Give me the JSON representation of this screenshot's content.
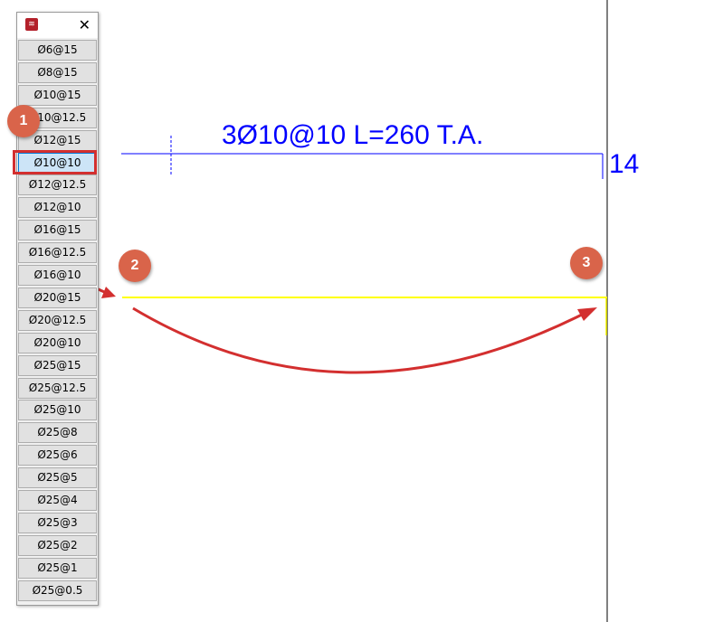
{
  "panel": {
    "close_label": "✕",
    "selected": "Ø10@10",
    "items": [
      "Ø6@15",
      "Ø8@15",
      "Ø10@15",
      "Ø10@12.5",
      "Ø12@15",
      "Ø10@10",
      "Ø12@12.5",
      "Ø12@10",
      "Ø16@15",
      "Ø16@12.5",
      "Ø16@10",
      "Ø20@15",
      "Ø20@12.5",
      "Ø20@10",
      "Ø25@15",
      "Ø25@12.5",
      "Ø25@10",
      "Ø25@8",
      "Ø25@6",
      "Ø25@5",
      "Ø25@4",
      "Ø25@3",
      "Ø25@2",
      "Ø25@1",
      "Ø25@0.5"
    ]
  },
  "drawing": {
    "rebar_label": "3Ø10@10 L=260 T.A.",
    "dimension_value": "14",
    "colors": {
      "annotation": "#0000ff",
      "selected_line": "#ffff00",
      "wall": "#000000",
      "arrow": "#d32f2f"
    }
  },
  "steps": [
    "1",
    "2",
    "3"
  ]
}
